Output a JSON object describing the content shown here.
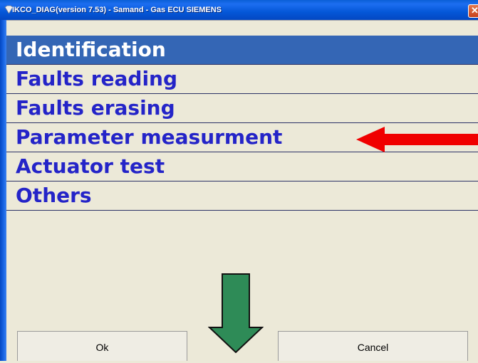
{
  "window": {
    "title": "IKCO_DIAG(version 7.53) - Samand - Gas ECU SIEMENS",
    "close_glyph": "✕"
  },
  "menu": {
    "items": [
      {
        "label": "Identification",
        "selected": true
      },
      {
        "label": "Faults reading",
        "selected": false
      },
      {
        "label": "Faults erasing",
        "selected": false
      },
      {
        "label": "Parameter measurment",
        "selected": false
      },
      {
        "label": "Actuator test",
        "selected": false
      },
      {
        "label": "Others",
        "selected": false
      }
    ]
  },
  "buttons": {
    "ok_label": "Ok",
    "cancel_label": "Cancel"
  },
  "annotations": {
    "red_arrow_color": "#f00000",
    "green_arrow_color": "#2e8b57"
  },
  "colors": {
    "selection_bg": "#3466b5",
    "menu_text": "#2424c8",
    "titlebar": "#0457d8"
  }
}
